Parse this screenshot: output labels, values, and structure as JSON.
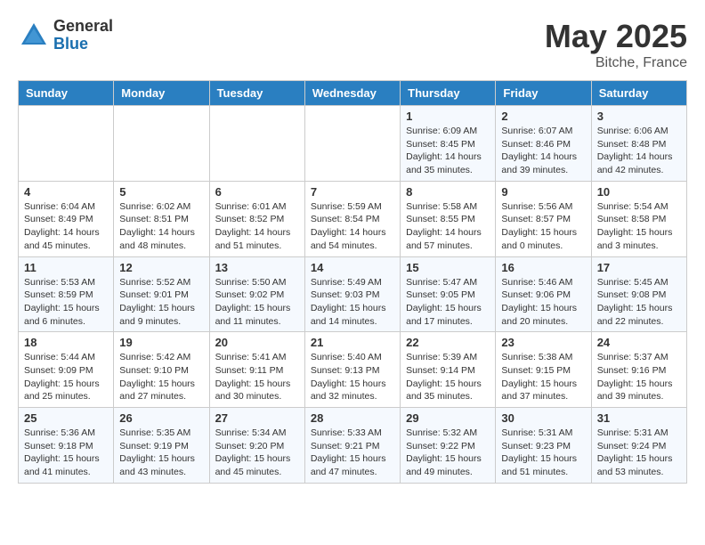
{
  "header": {
    "logo_general": "General",
    "logo_blue": "Blue",
    "month_title": "May 2025",
    "location": "Bitche, France"
  },
  "weekdays": [
    "Sunday",
    "Monday",
    "Tuesday",
    "Wednesday",
    "Thursday",
    "Friday",
    "Saturday"
  ],
  "weeks": [
    [
      {
        "day": "",
        "info": ""
      },
      {
        "day": "",
        "info": ""
      },
      {
        "day": "",
        "info": ""
      },
      {
        "day": "",
        "info": ""
      },
      {
        "day": "1",
        "info": "Sunrise: 6:09 AM\nSunset: 8:45 PM\nDaylight: 14 hours\nand 35 minutes."
      },
      {
        "day": "2",
        "info": "Sunrise: 6:07 AM\nSunset: 8:46 PM\nDaylight: 14 hours\nand 39 minutes."
      },
      {
        "day": "3",
        "info": "Sunrise: 6:06 AM\nSunset: 8:48 PM\nDaylight: 14 hours\nand 42 minutes."
      }
    ],
    [
      {
        "day": "4",
        "info": "Sunrise: 6:04 AM\nSunset: 8:49 PM\nDaylight: 14 hours\nand 45 minutes."
      },
      {
        "day": "5",
        "info": "Sunrise: 6:02 AM\nSunset: 8:51 PM\nDaylight: 14 hours\nand 48 minutes."
      },
      {
        "day": "6",
        "info": "Sunrise: 6:01 AM\nSunset: 8:52 PM\nDaylight: 14 hours\nand 51 minutes."
      },
      {
        "day": "7",
        "info": "Sunrise: 5:59 AM\nSunset: 8:54 PM\nDaylight: 14 hours\nand 54 minutes."
      },
      {
        "day": "8",
        "info": "Sunrise: 5:58 AM\nSunset: 8:55 PM\nDaylight: 14 hours\nand 57 minutes."
      },
      {
        "day": "9",
        "info": "Sunrise: 5:56 AM\nSunset: 8:57 PM\nDaylight: 15 hours\nand 0 minutes."
      },
      {
        "day": "10",
        "info": "Sunrise: 5:54 AM\nSunset: 8:58 PM\nDaylight: 15 hours\nand 3 minutes."
      }
    ],
    [
      {
        "day": "11",
        "info": "Sunrise: 5:53 AM\nSunset: 8:59 PM\nDaylight: 15 hours\nand 6 minutes."
      },
      {
        "day": "12",
        "info": "Sunrise: 5:52 AM\nSunset: 9:01 PM\nDaylight: 15 hours\nand 9 minutes."
      },
      {
        "day": "13",
        "info": "Sunrise: 5:50 AM\nSunset: 9:02 PM\nDaylight: 15 hours\nand 11 minutes."
      },
      {
        "day": "14",
        "info": "Sunrise: 5:49 AM\nSunset: 9:03 PM\nDaylight: 15 hours\nand 14 minutes."
      },
      {
        "day": "15",
        "info": "Sunrise: 5:47 AM\nSunset: 9:05 PM\nDaylight: 15 hours\nand 17 minutes."
      },
      {
        "day": "16",
        "info": "Sunrise: 5:46 AM\nSunset: 9:06 PM\nDaylight: 15 hours\nand 20 minutes."
      },
      {
        "day": "17",
        "info": "Sunrise: 5:45 AM\nSunset: 9:08 PM\nDaylight: 15 hours\nand 22 minutes."
      }
    ],
    [
      {
        "day": "18",
        "info": "Sunrise: 5:44 AM\nSunset: 9:09 PM\nDaylight: 15 hours\nand 25 minutes."
      },
      {
        "day": "19",
        "info": "Sunrise: 5:42 AM\nSunset: 9:10 PM\nDaylight: 15 hours\nand 27 minutes."
      },
      {
        "day": "20",
        "info": "Sunrise: 5:41 AM\nSunset: 9:11 PM\nDaylight: 15 hours\nand 30 minutes."
      },
      {
        "day": "21",
        "info": "Sunrise: 5:40 AM\nSunset: 9:13 PM\nDaylight: 15 hours\nand 32 minutes."
      },
      {
        "day": "22",
        "info": "Sunrise: 5:39 AM\nSunset: 9:14 PM\nDaylight: 15 hours\nand 35 minutes."
      },
      {
        "day": "23",
        "info": "Sunrise: 5:38 AM\nSunset: 9:15 PM\nDaylight: 15 hours\nand 37 minutes."
      },
      {
        "day": "24",
        "info": "Sunrise: 5:37 AM\nSunset: 9:16 PM\nDaylight: 15 hours\nand 39 minutes."
      }
    ],
    [
      {
        "day": "25",
        "info": "Sunrise: 5:36 AM\nSunset: 9:18 PM\nDaylight: 15 hours\nand 41 minutes."
      },
      {
        "day": "26",
        "info": "Sunrise: 5:35 AM\nSunset: 9:19 PM\nDaylight: 15 hours\nand 43 minutes."
      },
      {
        "day": "27",
        "info": "Sunrise: 5:34 AM\nSunset: 9:20 PM\nDaylight: 15 hours\nand 45 minutes."
      },
      {
        "day": "28",
        "info": "Sunrise: 5:33 AM\nSunset: 9:21 PM\nDaylight: 15 hours\nand 47 minutes."
      },
      {
        "day": "29",
        "info": "Sunrise: 5:32 AM\nSunset: 9:22 PM\nDaylight: 15 hours\nand 49 minutes."
      },
      {
        "day": "30",
        "info": "Sunrise: 5:31 AM\nSunset: 9:23 PM\nDaylight: 15 hours\nand 51 minutes."
      },
      {
        "day": "31",
        "info": "Sunrise: 5:31 AM\nSunset: 9:24 PM\nDaylight: 15 hours\nand 53 minutes."
      }
    ]
  ]
}
